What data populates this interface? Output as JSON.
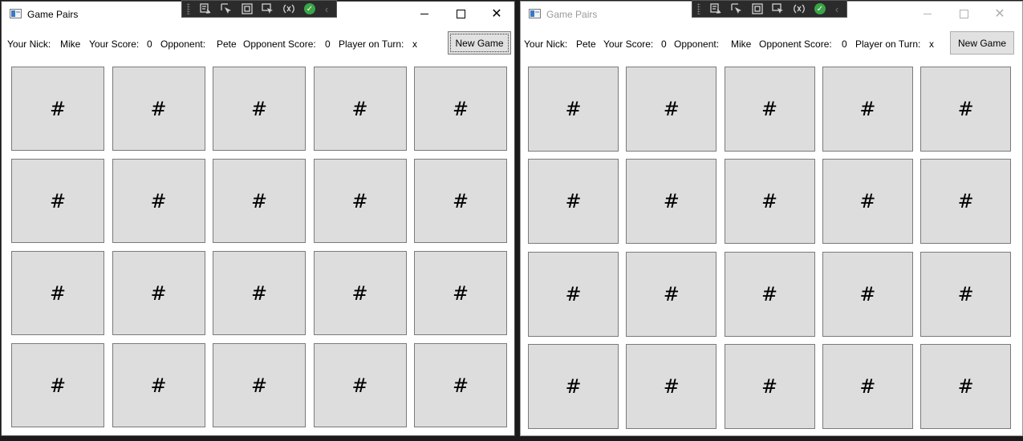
{
  "windows": [
    {
      "title": "Game Pairs",
      "your_nick_label": "Your Nick:",
      "your_nick": "Mike",
      "your_score_label": "Your Score:",
      "your_score": "0",
      "opponent_label": "Opponent:",
      "opponent": "Pete",
      "opponent_score_label": "Opponent Score:",
      "opponent_score": "0",
      "turn_label": "Player on Turn:",
      "turn_value": "x",
      "new_game_label": "New Game",
      "cards": [
        "#",
        "#",
        "#",
        "#",
        "#",
        "#",
        "#",
        "#",
        "#",
        "#",
        "#",
        "#",
        "#",
        "#",
        "#",
        "#",
        "#",
        "#",
        "#",
        "#"
      ]
    },
    {
      "title": "Game Pairs",
      "your_nick_label": "Your Nick:",
      "your_nick": "Pete",
      "your_score_label": "Your Score:",
      "your_score": "0",
      "opponent_label": "Opponent:",
      "opponent": "Mike",
      "opponent_score_label": "Opponent Score:",
      "opponent_score": "0",
      "turn_label": "Player on Turn:",
      "turn_value": "x",
      "new_game_label": "New Game",
      "cards": [
        "#",
        "#",
        "#",
        "#",
        "#",
        "#",
        "#",
        "#",
        "#",
        "#",
        "#",
        "#",
        "#",
        "#",
        "#",
        "#",
        "#",
        "#",
        "#",
        "#"
      ]
    }
  ],
  "debug_toolbar": {
    "icons": [
      "select-element-icon",
      "pointer-select-icon",
      "display-adorners-icon",
      "track-focused-element-icon",
      "binding-failures-icon",
      "hot-reload-ok-icon",
      "collapse-chevron-icon"
    ],
    "status_color": "#3aa547"
  },
  "colors": {
    "card_background": "#dddddd",
    "card_border": "#7a7a7a",
    "button_background": "#e1e1e1"
  }
}
